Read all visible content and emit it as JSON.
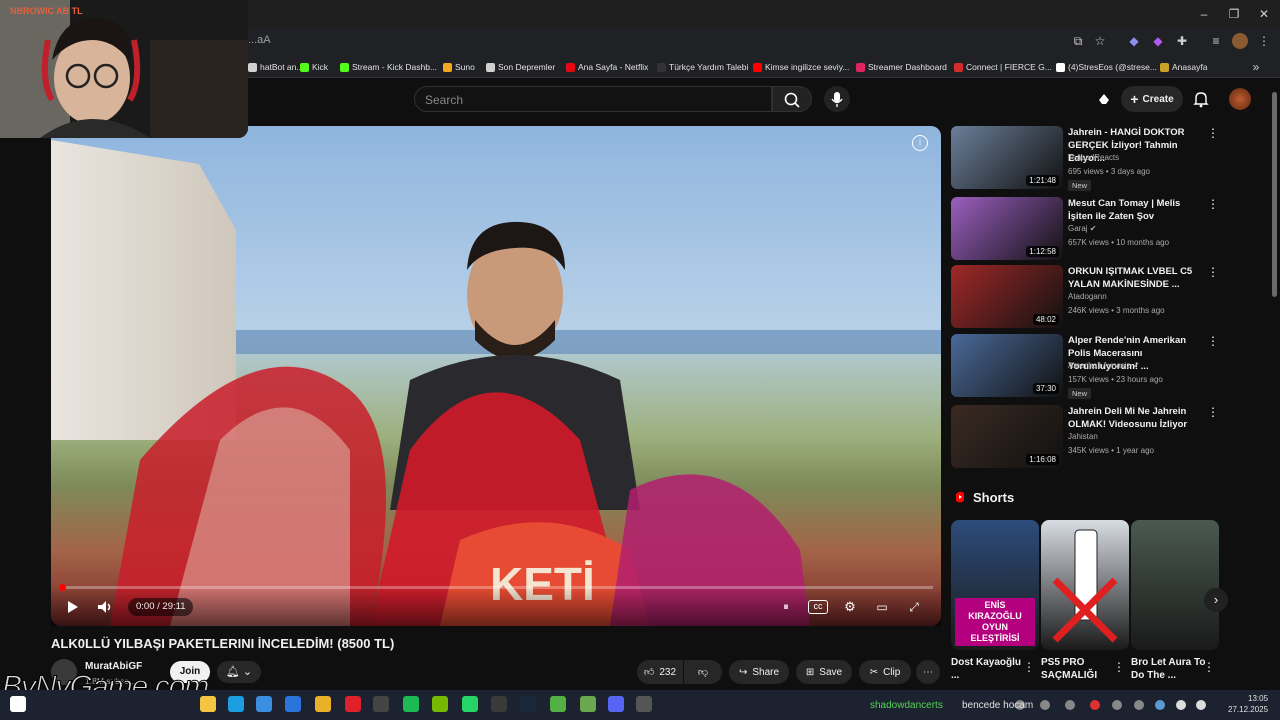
{
  "browser": {
    "url": "...aA",
    "window_controls": {
      "minimize": "–",
      "maximize": "❐",
      "close": "✕"
    },
    "bookmarks": [
      {
        "label": "hatBot an...",
        "color": "#d0d0d0"
      },
      {
        "label": "Kick",
        "color": "#53fc18"
      },
      {
        "label": "Stream - Kick Dashb...",
        "color": "#53fc18"
      },
      {
        "label": "Suno",
        "color": "#f5a623"
      },
      {
        "label": "Son Depremler",
        "color": "#cfcfcf"
      },
      {
        "label": "Ana Sayfa - Netflix",
        "color": "#e50914"
      },
      {
        "label": "Türkçe Yardım Talebi",
        "color": "#333333"
      },
      {
        "label": "Kimse ingilizce seviy...",
        "color": "#ff0000"
      },
      {
        "label": "Streamer Dashboard",
        "color": "#e0245e"
      },
      {
        "label": "Connect | FIERCE G...",
        "color": "#d42b2b"
      },
      {
        "label": "(4)StresEos (@strese...",
        "color": "#ffffff"
      },
      {
        "label": "Anasayfa",
        "color": "#c9a227"
      }
    ]
  },
  "webcam": {
    "tag": "NBROWIC AB TL"
  },
  "header": {
    "search_placeholder": "Search",
    "create_label": "Create"
  },
  "player": {
    "time": "0:00 / 29:11",
    "progress": 0.0
  },
  "video": {
    "title": "ALK0LLÜ YILBAŞI PAKETLERINI İNCELEDİM! (8500 TL)",
    "channel": "MuratAbiGF",
    "subs": "1.8M subsc...",
    "join_label": "Join",
    "likes": "232",
    "share_label": "Share",
    "save_label": "Save",
    "clip_label": "Clip",
    "watermark": "ByNvGame.com"
  },
  "recommendations": [
    {
      "title": "Jahrein - HANGİ DOKTOR GERÇEK İzliyor! Tahmin Ediyor...",
      "channel": "TeapodReacts",
      "meta": "695 views • 3 days ago",
      "duration": "1:21:48",
      "new": "New",
      "verified": false,
      "thumb": "#6b7f99"
    },
    {
      "title": "Mesut Can Tomay | Melis İşiten ile Zaten Şov",
      "channel": "Garaj",
      "meta": "657K views • 10 months ago",
      "duration": "1:12:58",
      "new": "",
      "verified": true,
      "thumb": "#9b5fc0"
    },
    {
      "title": "ORKUN IŞITMAK LVBEL C5 YALAN MAKİNESİNDE ...",
      "channel": "Atadogann",
      "meta": "246K views • 3 months ago",
      "duration": "48:02",
      "new": "",
      "verified": false,
      "thumb": "#a02828"
    },
    {
      "title": "Alper Rende'nin Amerikan Polis Macerasını Yorumluyorum! ...",
      "channel": "Amerikali Aynasiz",
      "meta": "157K views • 23 hours ago",
      "duration": "37:30",
      "new": "New",
      "verified": true,
      "thumb": "#4a6a9a"
    },
    {
      "title": "Jahrein Deli Mi Ne Jahrein OLMAK! Videosunu İzliyor",
      "channel": "Jahistan",
      "meta": "345K views • 1 year ago",
      "duration": "1:16:08",
      "new": "",
      "verified": false,
      "thumb": "#3a2a22"
    }
  ],
  "shorts": {
    "heading": "Shorts",
    "items": [
      {
        "title": "Dost Kayaoğlu ...",
        "overlay": "ENİS KIRAZOĞLU OYUN ELEŞTİRİSİ",
        "bg": "#2d4c7a"
      },
      {
        "title": "PS5 PRO SAÇMALIĞI",
        "overlay": "",
        "bg": "#d8dde4"
      },
      {
        "title": "Bro Let Aura To Do The ...",
        "overlay": "",
        "bg": "#4a5a50"
      }
    ]
  },
  "taskbar": {
    "tray_text1": "shadowdancerts",
    "tray_text2": "bencede hocam",
    "time": "13:05",
    "date": "27.12.2025"
  }
}
